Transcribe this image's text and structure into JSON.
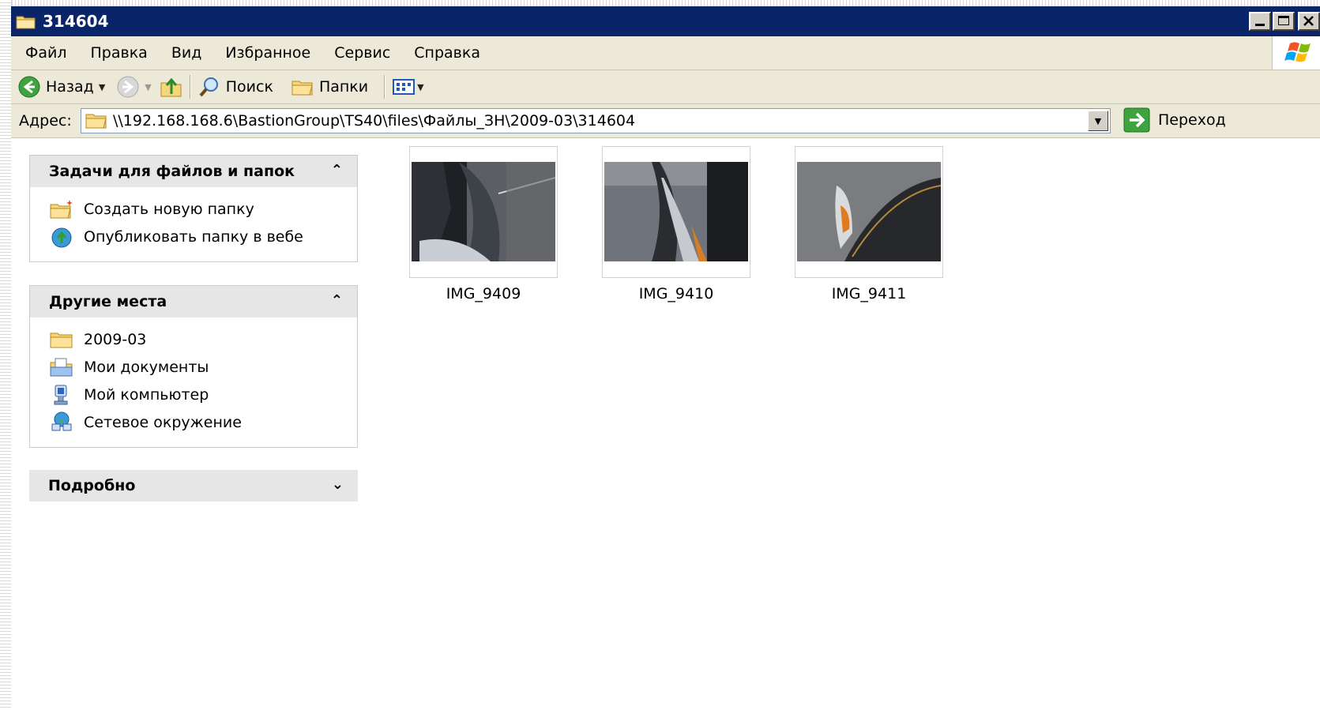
{
  "window": {
    "title": "314604"
  },
  "menu": [
    "Файл",
    "Правка",
    "Вид",
    "Избранное",
    "Сервис",
    "Справка"
  ],
  "toolbar": {
    "back_label": "Назад",
    "search_label": "Поиск",
    "folders_label": "Папки"
  },
  "address": {
    "label": "Адрес:",
    "path": "\\\\192.168.168.6\\BastionGroup\\TS40\\files\\Файлы_ЗН\\2009-03\\314604",
    "go_label": "Переход"
  },
  "panes": {
    "tasks": {
      "title": "Задачи для файлов и папок",
      "items": [
        "Создать новую папку",
        "Опубликовать папку в вебе"
      ]
    },
    "places": {
      "title": "Другие места",
      "items": [
        "2009-03",
        "Мои документы",
        "Мой компьютер",
        "Сетевое окружение"
      ]
    },
    "details": {
      "title": "Подробно"
    }
  },
  "files": [
    {
      "name": "IMG_9409"
    },
    {
      "name": "IMG_9410"
    },
    {
      "name": "IMG_9411"
    }
  ],
  "colors": {
    "titlebar": "#0a246a",
    "chrome": "#ece9d8",
    "pane_header": "#e6e6e6"
  }
}
